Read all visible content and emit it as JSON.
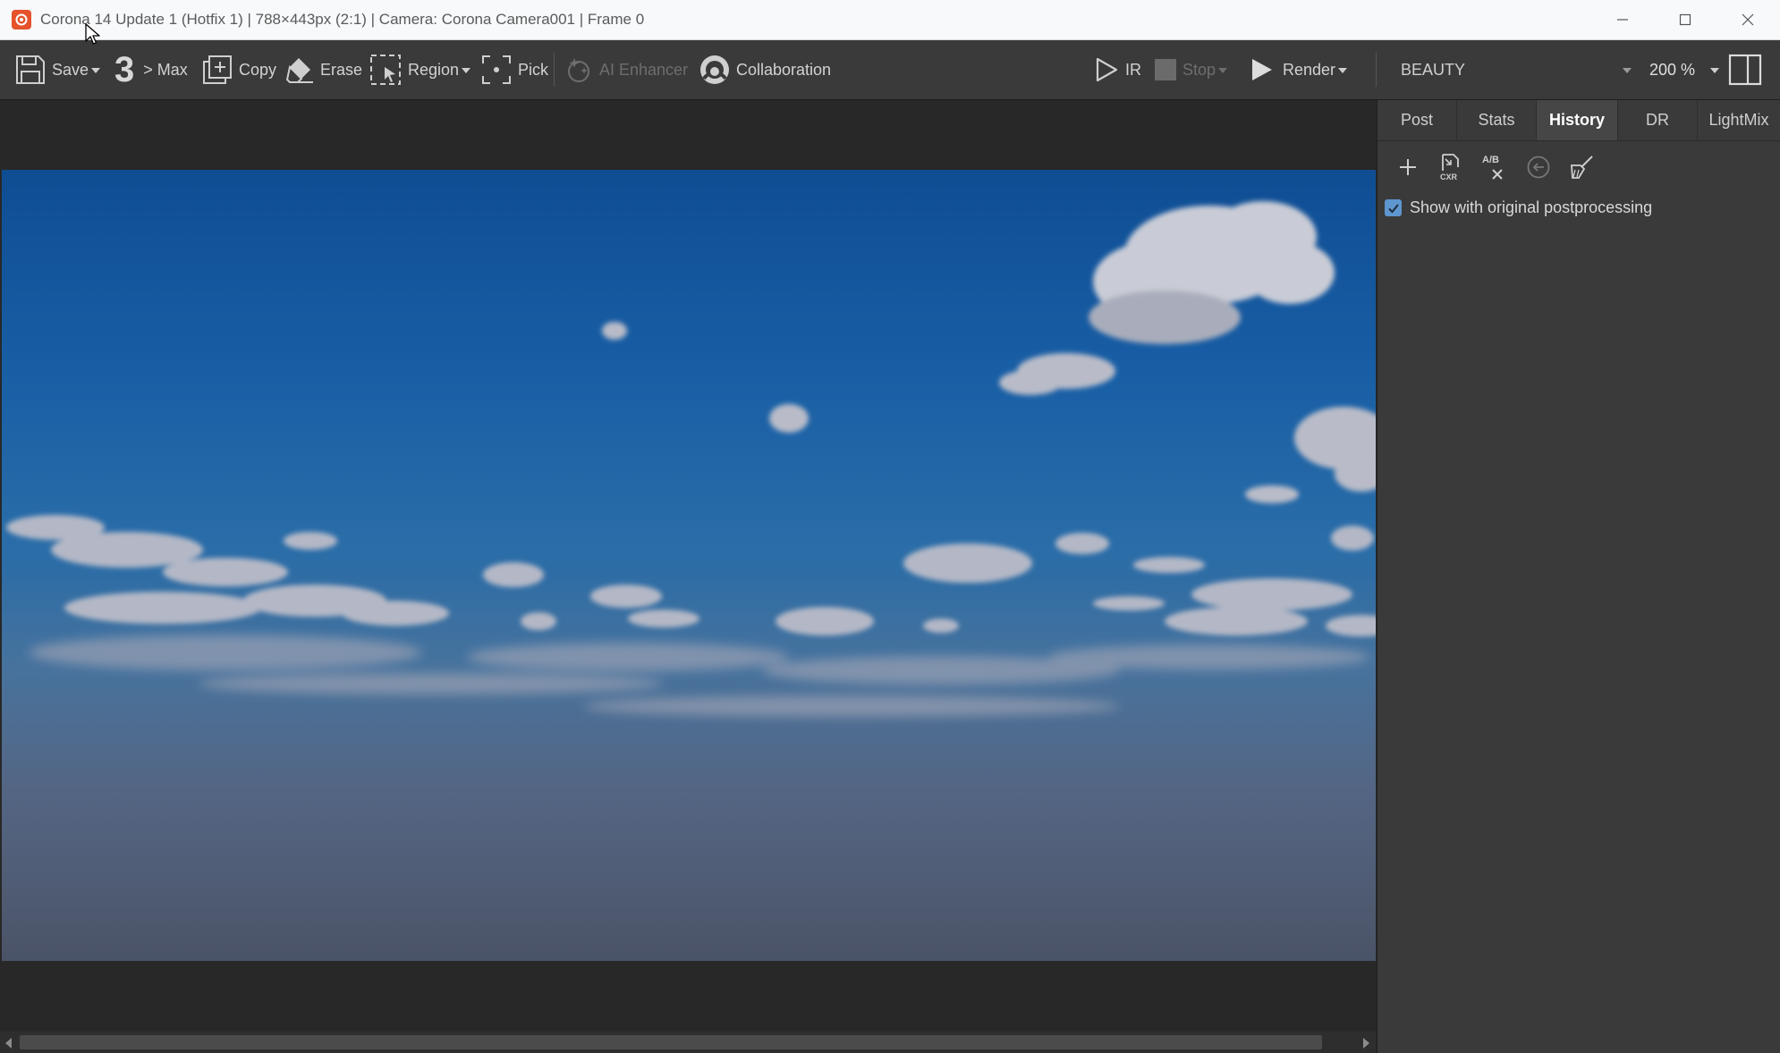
{
  "window": {
    "title": "Corona 14 Update 1 (Hotfix 1) | 788×443px (2:1) | Camera: Corona Camera001 | Frame 0",
    "app_icon": "corona-logo-icon",
    "controls": [
      "minimize-icon",
      "maximize-icon",
      "close-icon"
    ]
  },
  "toolbar": {
    "save_label": "Save",
    "max_number": "3",
    "max_label": "> Max",
    "copy_label": "Copy",
    "erase_label": "Erase",
    "region_label": "Region",
    "pick_label": "Pick",
    "ai_enhancer_label": "AI Enhancer",
    "collaboration_label": "Collaboration",
    "ir_label": "IR",
    "stop_label": "Stop",
    "render_label": "Render",
    "channel_value": "BEAUTY",
    "zoom_value": "200 %"
  },
  "panel": {
    "tabs": [
      {
        "label": "Post",
        "active": false
      },
      {
        "label": "Stats",
        "active": false
      },
      {
        "label": "History",
        "active": true
      },
      {
        "label": "DR",
        "active": false
      },
      {
        "label": "LightMix",
        "active": false
      }
    ],
    "history_tools": [
      "add-icon",
      "save-cxr-icon",
      "ab-compare-icon",
      "restore-icon",
      "clear-history-icon"
    ],
    "show_original_label": "Show with original postprocessing",
    "show_original_checked": true
  },
  "colors": {
    "toolbar_bg": "#3a3a3a",
    "viewport_bg": "#282828",
    "accent": "#5e96d0",
    "title_bar_bg": "#f7f9fb"
  }
}
